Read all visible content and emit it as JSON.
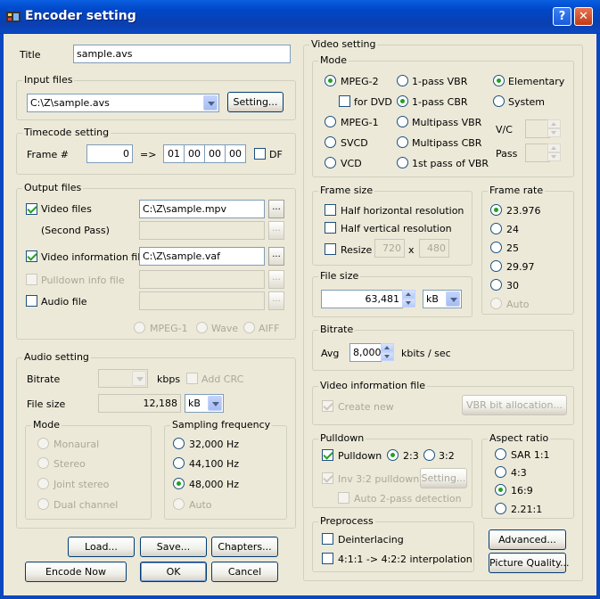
{
  "window": {
    "title": "Encoder setting",
    "help": "?",
    "close": "✕"
  },
  "title_field": {
    "label": "Title",
    "value": "sample.avs"
  },
  "input_files": {
    "group": "Input files",
    "value": "C:\\Z\\sample.avs",
    "setting": "Setting..."
  },
  "timecode": {
    "group": "Timecode setting",
    "frame_label": "Frame #",
    "frame": "0",
    "arrow": "=>",
    "h": "01",
    "m": "00",
    "s": "00",
    "f": "00",
    "df": "DF"
  },
  "output_files": {
    "group": "Output files",
    "video_files": "Video files",
    "video_value": "C:\\Z\\sample.mpv",
    "second_pass": "(Second Pass)",
    "video_info": "Video information file",
    "video_info_value": "C:\\Z\\sample.vaf",
    "pulldown_info": "Pulldown info file",
    "audio_file": "Audio file",
    "browse": "...",
    "fmt_mpeg1": "MPEG-1",
    "fmt_wave": "Wave",
    "fmt_aiff": "AIFF"
  },
  "audio": {
    "group": "Audio setting",
    "bitrate": "Bitrate",
    "kbps": "kbps",
    "add_crc": "Add CRC",
    "file_size": "File size",
    "file_size_value": "12,188",
    "unit": "kB",
    "mode_group": "Mode",
    "mode": [
      "Monaural",
      "Stereo",
      "Joint stereo",
      "Dual channel"
    ],
    "freq_group": "Sampling frequency",
    "freq": [
      "32,000 Hz",
      "44,100 Hz",
      "48,000 Hz",
      "Auto"
    ]
  },
  "buttons": {
    "load": "Load...",
    "save": "Save...",
    "chapters": "Chapters...",
    "encode_now": "Encode Now",
    "ok": "OK",
    "cancel": "Cancel"
  },
  "video": {
    "group": "Video setting",
    "mode_group": "Mode",
    "mpeg2": "MPEG-2",
    "for_dvd": "for DVD",
    "mpeg1": "MPEG-1",
    "svcd": "SVCD",
    "vcd": "VCD",
    "pass1_vbr": "1-pass VBR",
    "pass1_cbr": "1-pass CBR",
    "multi_vbr": "Multipass VBR",
    "multi_cbr": "Multipass CBR",
    "first_pass": "1st pass of VBR",
    "elementary": "Elementary",
    "system": "System",
    "vc": "V/C",
    "pass": "Pass"
  },
  "frame_size": {
    "group": "Frame size",
    "half_h": "Half horizontal resolution",
    "half_v": "Half vertical resolution",
    "resize": "Resize",
    "w": "720",
    "x": "x",
    "h": "480"
  },
  "frame_rate": {
    "group": "Frame rate",
    "rates": [
      "23.976",
      "24",
      "25",
      "29.97",
      "30",
      "Auto"
    ]
  },
  "file_size": {
    "group": "File size",
    "value": "63,481",
    "unit": "kB"
  },
  "bitrate": {
    "group": "Bitrate",
    "avg": "Avg",
    "value": "8,000",
    "unit": "kbits / sec"
  },
  "video_info": {
    "group": "Video information file",
    "create_new": "Create new",
    "vbr_alloc": "VBR bit allocation..."
  },
  "pulldown": {
    "group": "Pulldown",
    "pulldown": "Pulldown",
    "r23": "2:3",
    "r32": "3:2",
    "inv": "Inv 3:2 pulldown",
    "setting": "Setting...",
    "auto2": "Auto 2-pass detection"
  },
  "aspect": {
    "group": "Aspect ratio",
    "ratios": [
      "SAR 1:1",
      "4:3",
      "16:9",
      "2.21:1"
    ]
  },
  "preprocess": {
    "group": "Preprocess",
    "deinterlacing": "Deinterlacing",
    "interp": "4:1:1 -> 4:2:2 interpolation",
    "advanced": "Advanced...",
    "picture_quality": "Picture Quality..."
  }
}
